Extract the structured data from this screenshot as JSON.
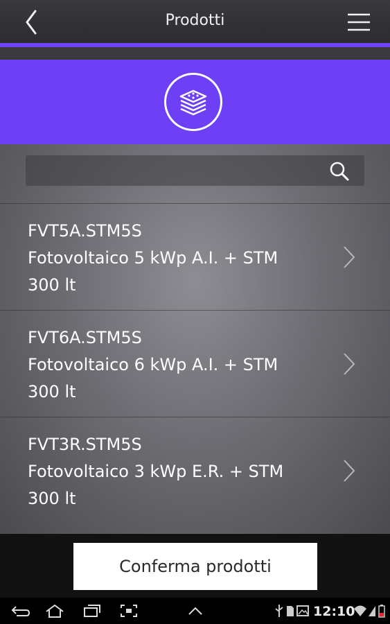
{
  "header": {
    "title": "Prodotti"
  },
  "colors": {
    "accent": "#6d3ff5",
    "background": "#6e6d73"
  },
  "icons": {
    "back": "chevron-left-icon",
    "menu": "hamburger-menu-icon",
    "banner": "layers-stack-icon",
    "search": "search-icon",
    "row_chevron": "chevron-right-icon"
  },
  "search": {
    "value": "",
    "placeholder": ""
  },
  "products": [
    {
      "code": "FVT5A.STM5S",
      "description": "Fotovoltaico 5 kWp A.I. + STM",
      "capacity": "300 lt"
    },
    {
      "code": "FVT6A.STM5S",
      "description": "Fotovoltaico 6 kWp A.I. + STM",
      "capacity": "300 lt"
    },
    {
      "code": "FVT3R.STM5S",
      "description": "Fotovoltaico 3 kWp E.R. + STM",
      "capacity": "300 lt"
    }
  ],
  "confirm_label": "Conferma prodotti",
  "status_bar": {
    "time": "12:10"
  }
}
